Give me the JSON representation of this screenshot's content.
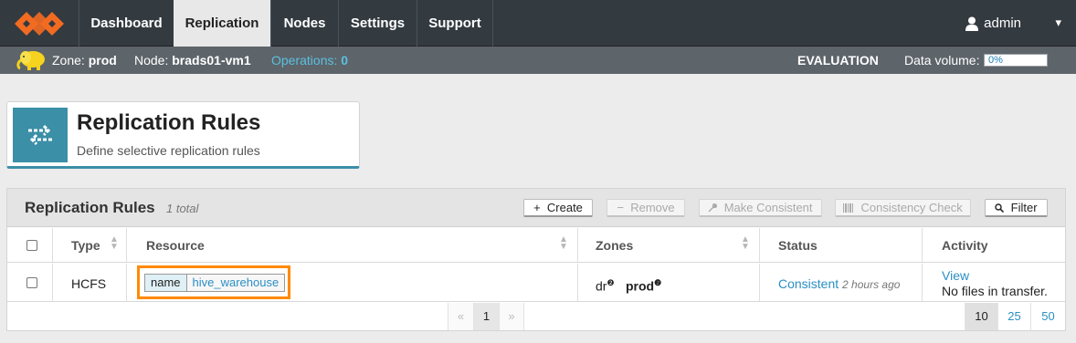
{
  "colors": {
    "nav_bg": "#333a40",
    "subbar_bg": "#5d646a",
    "accent": "#3b8fa6",
    "link": "#2b8fc4",
    "highlight": "#ff8a00",
    "logo": "#f26b21"
  },
  "nav": {
    "tabs": [
      {
        "label": "Dashboard",
        "active": false
      },
      {
        "label": "Replication",
        "active": true
      },
      {
        "label": "Nodes",
        "active": false
      },
      {
        "label": "Settings",
        "active": false
      },
      {
        "label": "Support",
        "active": false
      }
    ],
    "user": {
      "icon": "user-icon",
      "name": "admin",
      "caret": "▾"
    }
  },
  "subbar": {
    "zone_label": "Zone:",
    "zone_value": "prod",
    "node_label": "Node:",
    "node_value": "brads01-vm1",
    "operations_label": "Operations:",
    "operations_value": "0",
    "evaluation": "EVALUATION",
    "data_volume_label": "Data volume:",
    "data_volume_value": "0%",
    "data_volume_fraction": 0.0
  },
  "header": {
    "icon": "swap-arrows-icon",
    "title": "Replication Rules",
    "subtitle": "Define selective replication rules"
  },
  "panel": {
    "title": "Replication Rules",
    "count": "1 total",
    "buttons": [
      {
        "icon": "+",
        "label": "Create",
        "enabled": true
      },
      {
        "icon": "−",
        "label": "Remove",
        "enabled": false
      },
      {
        "icon": "wrench-icon",
        "label": "Make Consistent",
        "enabled": false
      },
      {
        "icon": "barcode-icon",
        "label": "Consistency Check",
        "enabled": false
      },
      {
        "icon": "search-icon",
        "label": "Filter",
        "enabled": true
      }
    ]
  },
  "table": {
    "columns": [
      "Type",
      "Resource",
      "Zones",
      "Status",
      "Activity"
    ],
    "rows": [
      {
        "type": "HCFS",
        "resource_key": "name",
        "resource_value": "hive_warehouse",
        "zone_1": "dr",
        "zone_2": "prod",
        "status": "Consistent",
        "status_time": "2 hours ago",
        "activity_link": "View",
        "activity_text": "No files in transfer."
      }
    ]
  },
  "pagination": {
    "prev": "«",
    "current": "1",
    "next": "»",
    "page_sizes": [
      "10",
      "25",
      "50"
    ],
    "selected_size": "10"
  }
}
